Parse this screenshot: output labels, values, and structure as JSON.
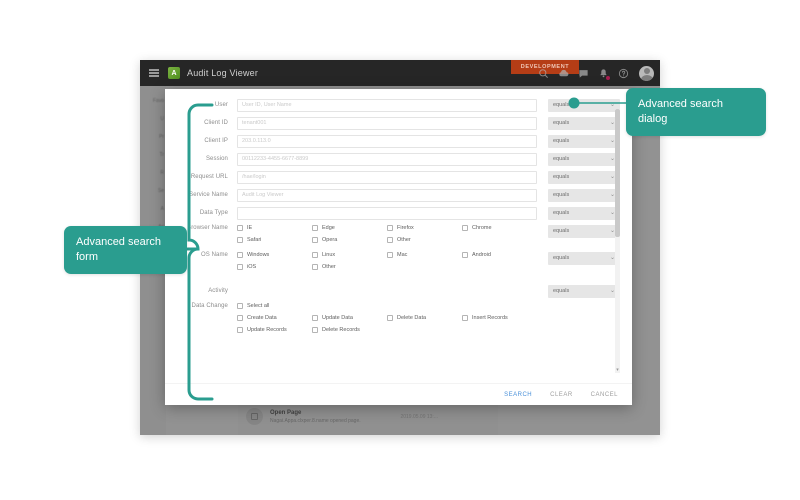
{
  "app": {
    "title": "Audit Log Viewer",
    "env_badge": "DEVELOPMENT",
    "menu_icon": "hamburger-icon",
    "logo_icon": "app-logo-icon",
    "icons": [
      "search-icon",
      "cloud-icon",
      "chat-icon",
      "bell-icon",
      "help-icon",
      "avatar-icon"
    ]
  },
  "background": {
    "sidebar_items": [
      "Favo",
      "U",
      "Pr",
      "Tr",
      "R",
      "Se",
      "A",
      "Ac",
      "+"
    ],
    "list_item": {
      "title": "Open Page",
      "subtitle": "Nagai.Appa.clxper.8.name opened page.",
      "time": "2019.05.09 13:..."
    }
  },
  "dialog": {
    "fields": [
      {
        "label": "User",
        "placeholder": "User ID, User Name",
        "value": "",
        "operator": "equals"
      },
      {
        "label": "Client ID",
        "placeholder": "tenant001",
        "value": "",
        "operator": "equals"
      },
      {
        "label": "Client IP",
        "placeholder": "203.0.113.0",
        "value": "",
        "operator": "equals"
      },
      {
        "label": "Session",
        "placeholder": "00112233-4455-6677-8899",
        "value": "",
        "operator": "equals"
      },
      {
        "label": "Request URL",
        "placeholder": "/hae/login",
        "value": "",
        "operator": "equals"
      },
      {
        "label": "Service Name",
        "placeholder": "Audit Log Viewer",
        "value": "",
        "operator": "equals"
      },
      {
        "label": "Data Type",
        "placeholder": "",
        "value": "",
        "operator": "equals"
      }
    ],
    "browser": {
      "label": "Browser Name",
      "operator": "equals",
      "options": [
        "IE",
        "Edge",
        "Firefox",
        "Chrome",
        "Safari",
        "Opera",
        "Other"
      ]
    },
    "os": {
      "label": "OS Name",
      "operator": "equals",
      "options": [
        "Windows",
        "Linux",
        "Mac",
        "Android",
        "iOS",
        "Other"
      ]
    },
    "activity": {
      "label": "Activity",
      "operator": "equals"
    },
    "data_change": {
      "label": "Data Change",
      "select_all": "Select all",
      "options": [
        "Create Data",
        "Update Data",
        "Delete Data",
        "Insert Records"
      ],
      "clipped_options": [
        "Update Records",
        "Delete Records"
      ]
    },
    "actions": {
      "search": "SEARCH",
      "clear": "CLEAR",
      "cancel": "CANCEL"
    },
    "chevron": "⌄"
  },
  "callouts": {
    "dialog": "Advanced search dialog",
    "form": "Advanced search form"
  },
  "colors": {
    "accent": "#2a9d8f",
    "topbar": "#262626",
    "env_badge": "#b53d16",
    "primary_action": "#4a90d9",
    "badge_dot": "#d81b60"
  }
}
